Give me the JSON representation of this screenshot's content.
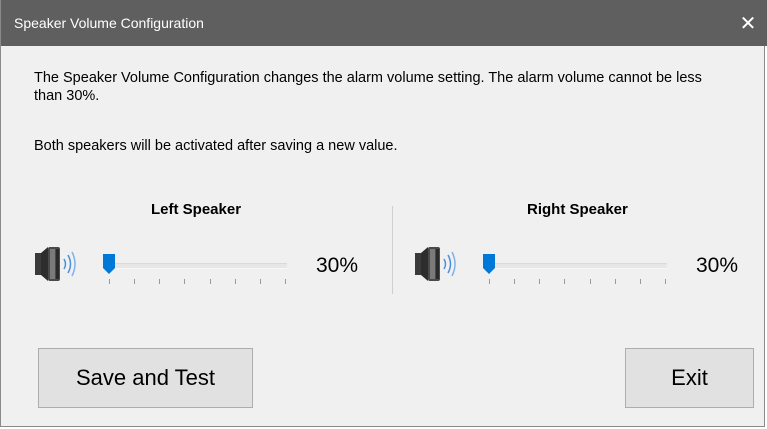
{
  "window": {
    "title": "Speaker Volume Configuration",
    "close_label": "✕"
  },
  "description": {
    "line1": "The Speaker Volume Configuration changes the alarm volume setting. The alarm volume cannot be less than 30%.",
    "line2": "Both speakers will be activated after saving a new value."
  },
  "speakers": {
    "left": {
      "title": "Left Speaker",
      "value": 30,
      "display": "30%"
    },
    "right": {
      "title": "Right Speaker",
      "value": 30,
      "display": "30%"
    }
  },
  "slider": {
    "min": 30,
    "max": 100,
    "tick_count": 8
  },
  "buttons": {
    "save": "Save and Test",
    "exit": "Exit"
  },
  "colors": {
    "titlebar": "#5f5f5f",
    "accent": "#0078d7",
    "window_bg": "#f0f0f0"
  }
}
